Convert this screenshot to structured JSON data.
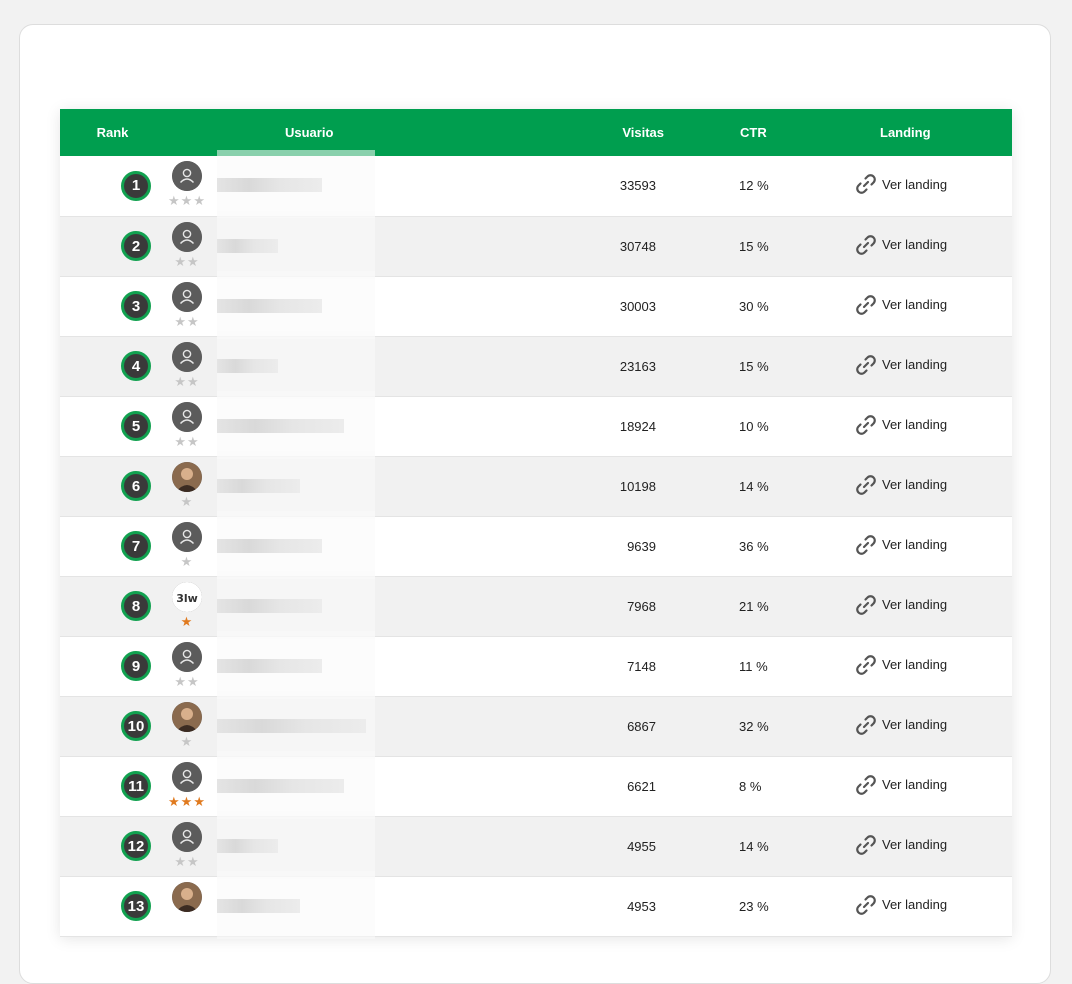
{
  "table": {
    "headers": {
      "rank": "Rank",
      "user": "Usuario",
      "visits": "Visitas",
      "ctr": "CTR",
      "landing": "Landing"
    },
    "rows": [
      {
        "rank": "1",
        "visits": "33593",
        "ctr": "12 %",
        "landing": "Ver landing",
        "avatar": "user-placeholder-icon",
        "stars": "3",
        "star_color": "gray"
      },
      {
        "rank": "2",
        "visits": "30748",
        "ctr": "15 %",
        "landing": "Ver landing",
        "avatar": "user-placeholder-icon",
        "stars": "2",
        "star_color": "gray"
      },
      {
        "rank": "3",
        "visits": "30003",
        "ctr": "30 %",
        "landing": "Ver landing",
        "avatar": "user-placeholder-icon",
        "stars": "2",
        "star_color": "gray"
      },
      {
        "rank": "4",
        "visits": "23163",
        "ctr": "15 %",
        "landing": "Ver landing",
        "avatar": "user-placeholder-icon",
        "stars": "2",
        "star_color": "gray"
      },
      {
        "rank": "5",
        "visits": "18924",
        "ctr": "10 %",
        "landing": "Ver landing",
        "avatar": "user-placeholder-icon",
        "stars": "2",
        "star_color": "gray"
      },
      {
        "rank": "6",
        "visits": "10198",
        "ctr": "14 %",
        "landing": "Ver landing",
        "avatar": "photo-avatar",
        "stars": "1",
        "star_color": "gray"
      },
      {
        "rank": "7",
        "visits": "9639",
        "ctr": "36 %",
        "landing": "Ver landing",
        "avatar": "user-placeholder-icon",
        "stars": "1",
        "star_color": "gray"
      },
      {
        "rank": "8",
        "visits": "7968",
        "ctr": "21 %",
        "landing": "Ver landing",
        "avatar": "logo-avatar",
        "stars": "1",
        "star_color": "orange"
      },
      {
        "rank": "9",
        "visits": "7148",
        "ctr": "11 %",
        "landing": "Ver landing",
        "avatar": "user-placeholder-icon",
        "stars": "2",
        "star_color": "gray"
      },
      {
        "rank": "10",
        "visits": "6867",
        "ctr": "32 %",
        "landing": "Ver landing",
        "avatar": "photo-avatar",
        "stars": "1",
        "star_color": "gray"
      },
      {
        "rank": "11",
        "visits": "6621",
        "ctr": "8 %",
        "landing": "Ver landing",
        "avatar": "user-placeholder-icon",
        "stars": "3",
        "star_color": "orange"
      },
      {
        "rank": "12",
        "visits": "4955",
        "ctr": "14 %",
        "landing": "Ver landing",
        "avatar": "user-placeholder-icon",
        "stars": "2",
        "star_color": "gray"
      },
      {
        "rank": "13",
        "visits": "4953",
        "ctr": "23 %",
        "landing": "Ver landing",
        "avatar": "photo-avatar",
        "stars": "0",
        "star_color": "gray"
      }
    ]
  },
  "colors": {
    "header_bg": "#009e4f",
    "badge_ring": "#12a150",
    "badge_fill": "#3a3a3a",
    "star_gray": "#c6c6c6",
    "star_orange": "#e07a1f"
  }
}
